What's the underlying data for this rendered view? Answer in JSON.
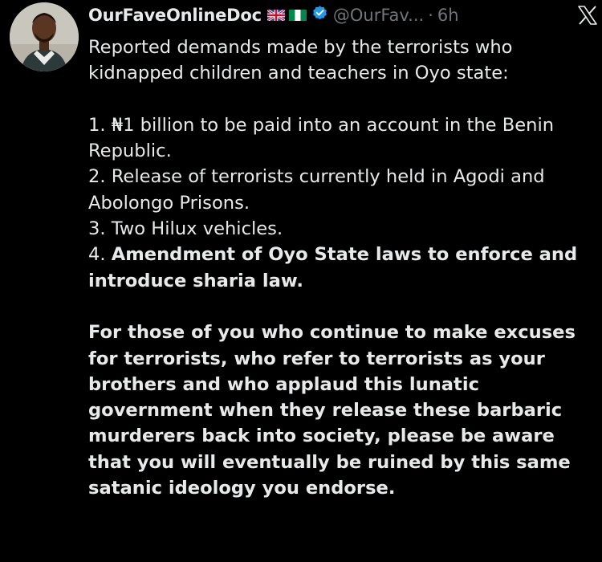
{
  "tweet": {
    "author": {
      "display_name": "OurFaveOnlineDoc",
      "flags": [
        "uk-flag",
        "nigeria-flag"
      ],
      "verified": true,
      "handle": "@OurFav...",
      "separator": "·",
      "time": "6h"
    },
    "platform_icon": "x-logo-icon",
    "body": {
      "intro": [
        "Reported demands made by the terrorists who",
        "kidnapped children and teachers in Oyo state:"
      ],
      "demands": [
        "1. ₦1 billion to be paid into an account in the Benin",
        "Republic.",
        "2. Release of terrorists currently held in Agodi and",
        "Abolongo Prisons.",
        "3. Two Hilux vehicles."
      ],
      "demand4_prefix": "4. ",
      "demand4_bold": [
        "Amendment of Oyo State laws to enforce and",
        "introduce sharia law."
      ],
      "closing": [
        "For those of you who continue to make excuses",
        "for terrorists, who refer to terrorists as your",
        "brothers and who applaud this lunatic",
        "government when they release these barbaric",
        "murderers back into society, please be aware",
        "that you will eventually be ruined by this same",
        "satanic ideology you endorse."
      ]
    }
  },
  "colors": {
    "background": "#000000",
    "text_primary": "#e7e9ea",
    "text_secondary": "#71767b",
    "verified_blue": "#1d9bf0"
  }
}
